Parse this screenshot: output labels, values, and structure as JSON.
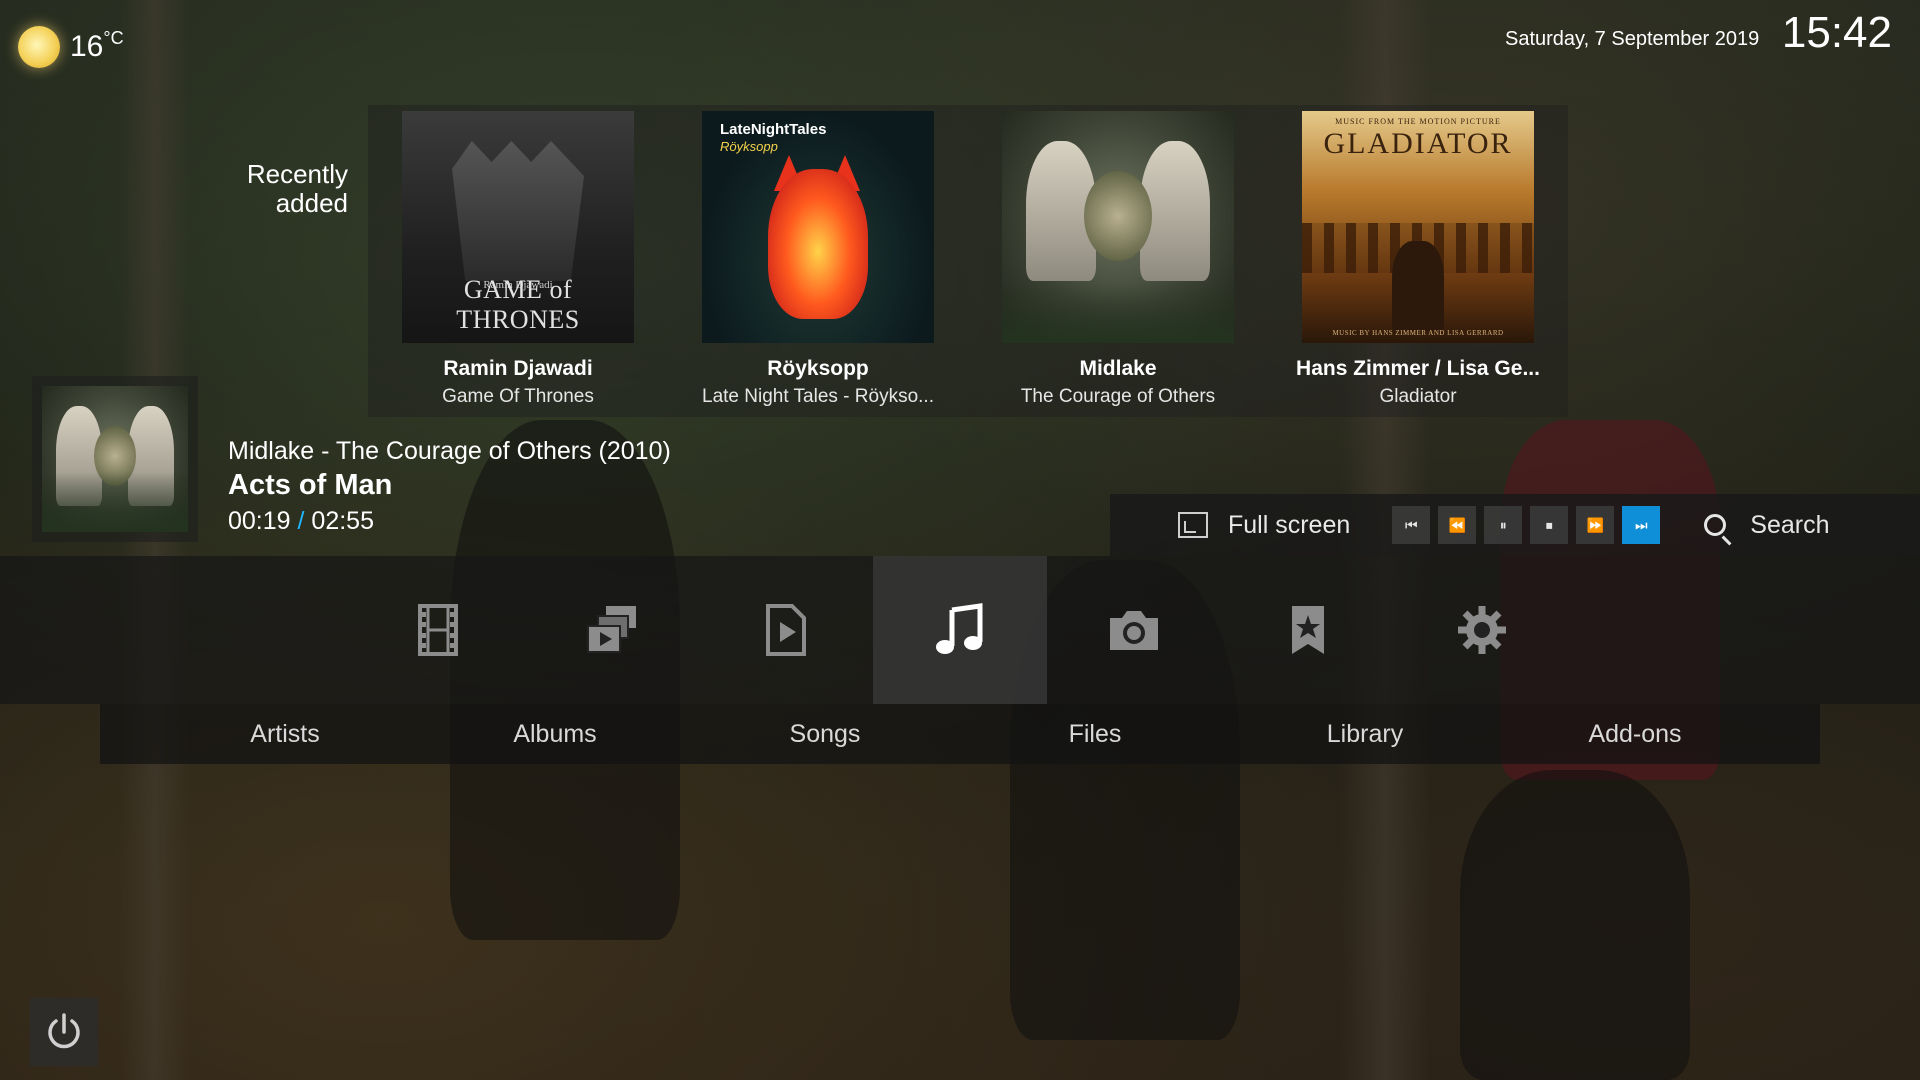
{
  "weather": {
    "temperature": "16",
    "unit": "°C",
    "icon": "sun-icon"
  },
  "datetime": {
    "date": "Saturday, 7 September 2019",
    "time": "15:42"
  },
  "recently_added": {
    "label_line1": "Recently",
    "label_line2": "added",
    "items": [
      {
        "artist": "Ramin Djawadi",
        "album": "Game Of Thrones",
        "cover_text_top": "Ramin Djawadi",
        "cover_text_bottom": "GAME of THRONES"
      },
      {
        "artist": "Röyksopp",
        "album": "Late Night Tales - Röykso...",
        "cover_text_top": "LateNightTales",
        "cover_text_bottom": "Röyksopp"
      },
      {
        "artist": "Midlake",
        "album": "The Courage of Others"
      },
      {
        "artist": "Hans Zimmer / Lisa Ge...",
        "album": "Gladiator",
        "cover_text_top": "MUSIC FROM THE MOTION PICTURE",
        "cover_text_title": "GLADIATOR",
        "cover_text_bottom": "MUSIC BY HANS ZIMMER AND LISA GERRARD"
      }
    ]
  },
  "now_playing": {
    "header": "Midlake - The Courage of Others (2010)",
    "track": "Acts of Man",
    "elapsed": "00:19",
    "separator": "/",
    "duration": "02:55"
  },
  "controls": {
    "fullscreen_label": "Full screen",
    "search_label": "Search",
    "buttons": [
      "skip-previous-icon",
      "rewind-icon",
      "pause-icon",
      "stop-icon",
      "fast-forward-icon",
      "skip-next-icon"
    ],
    "active_button": "skip-next-icon",
    "glyphs": {
      "prev": "⏮",
      "rew": "⏪",
      "pause": "⏸",
      "stop": "⏹",
      "ff": "⏩",
      "next": "⏭"
    }
  },
  "main_menu": {
    "items": [
      {
        "icon": "movies-icon"
      },
      {
        "icon": "tv-shows-icon"
      },
      {
        "icon": "music-videos-icon"
      },
      {
        "icon": "music-icon",
        "selected": true
      },
      {
        "icon": "pictures-icon"
      },
      {
        "icon": "favourites-icon"
      },
      {
        "icon": "settings-icon"
      }
    ]
  },
  "submenu": {
    "items": [
      "Artists",
      "Albums",
      "Songs",
      "Files",
      "Library",
      "Add-ons"
    ]
  },
  "colors": {
    "accent": "#1eb7ff",
    "active_button": "#0f8fd8"
  },
  "power": {
    "icon": "power-icon"
  }
}
